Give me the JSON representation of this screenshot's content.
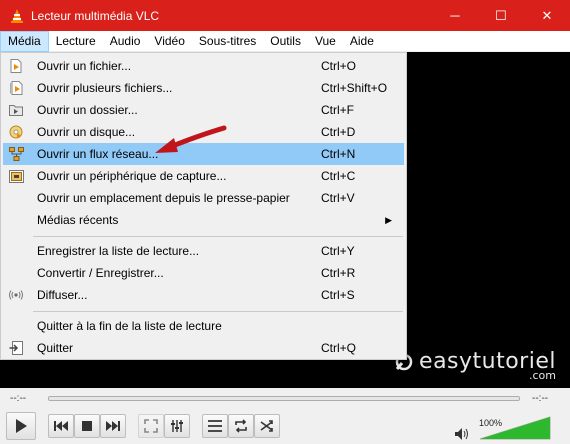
{
  "window": {
    "title": "Lecteur multimédia VLC",
    "minimize_glyph": "─",
    "maximize_glyph": "☐",
    "close_glyph": "✕",
    "accent": "#d9201b"
  },
  "menubar": {
    "items": [
      {
        "label": "Média",
        "active": true
      },
      {
        "label": "Lecture"
      },
      {
        "label": "Audio"
      },
      {
        "label": "Vidéo"
      },
      {
        "label": "Sous-titres"
      },
      {
        "label": "Outils"
      },
      {
        "label": "Vue"
      },
      {
        "label": "Aide"
      }
    ]
  },
  "media_menu": {
    "items": [
      {
        "label": "Ouvrir un fichier...",
        "shortcut": "Ctrl+O",
        "icon": "file-play-icon"
      },
      {
        "label": "Ouvrir plusieurs fichiers...",
        "shortcut": "Ctrl+Shift+O",
        "icon": "files-play-icon"
      },
      {
        "label": "Ouvrir un dossier...",
        "shortcut": "Ctrl+F",
        "icon": "folder-icon"
      },
      {
        "label": "Ouvrir un disque...",
        "shortcut": "Ctrl+D",
        "icon": "disc-icon"
      },
      {
        "label": "Ouvrir un flux réseau...",
        "shortcut": "Ctrl+N",
        "icon": "network-icon",
        "highlighted": true
      },
      {
        "label": "Ouvrir un périphérique de capture...",
        "shortcut": "Ctrl+C",
        "icon": "capture-device-icon"
      },
      {
        "label": "Ouvrir un emplacement depuis le presse-papier",
        "shortcut": "Ctrl+V",
        "icon": ""
      },
      {
        "label": "Médias récents",
        "shortcut": "",
        "icon": "",
        "submenu": "▶"
      },
      {
        "label": "Enregistrer la liste de lecture...",
        "shortcut": "Ctrl+Y",
        "icon": ""
      },
      {
        "label": "Convertir / Enregistrer...",
        "shortcut": "Ctrl+R",
        "icon": ""
      },
      {
        "label": "Diffuser...",
        "shortcut": "Ctrl+S",
        "icon": "stream-icon"
      },
      {
        "label": "Quitter à la fin de la liste de lecture",
        "shortcut": "",
        "icon": ""
      },
      {
        "label": "Quitter",
        "shortcut": "Ctrl+Q",
        "icon": "exit-icon"
      }
    ]
  },
  "watermark": {
    "main": "easytutoriel",
    "sub": ".com"
  },
  "seekbar": {
    "elapsed": "--:--",
    "remaining": "--:--"
  },
  "volume": {
    "percent_label": "100%",
    "level": 1.0
  }
}
